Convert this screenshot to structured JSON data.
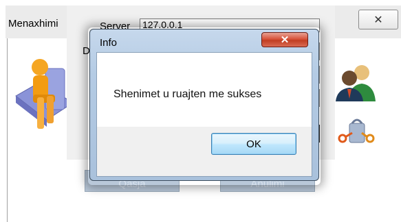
{
  "main_window": {
    "title": "Menaxhimi",
    "close_glyph": "✕"
  },
  "form": {
    "server_label": "Server",
    "server_value": "127.0.0.1",
    "db_label_fragment": "D",
    "login_button": "Qasja",
    "cancel_button": "Anulimi"
  },
  "dialog": {
    "title": "Info",
    "close_glyph": "✕",
    "message": "Shenimet u ruajten me sukses",
    "ok_label": "OK"
  },
  "icons": {
    "left": "person-chair-icon",
    "right_top": "users-icon",
    "right_bottom": "keys-lock-icon"
  },
  "colors": {
    "dialog_frame": "#b4cbe4",
    "close_red": "#c13d22",
    "ok_blue": "#bee6fd"
  }
}
